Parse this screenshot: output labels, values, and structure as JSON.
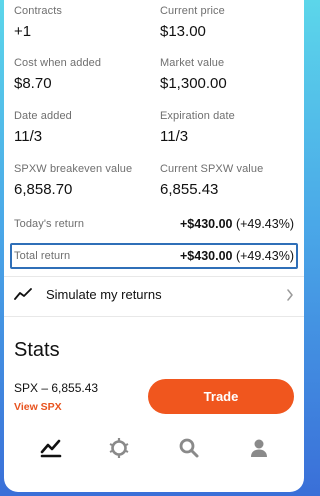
{
  "details": [
    {
      "label": "Contracts",
      "value": "+1"
    },
    {
      "label": "Current price",
      "value": "$13.00"
    },
    {
      "label": "Cost when added",
      "value": "$8.70"
    },
    {
      "label": "Market value",
      "value": "$1,300.00"
    },
    {
      "label": "Date added",
      "value": "11/3"
    },
    {
      "label": "Expiration date",
      "value": "11/3"
    },
    {
      "label": "SPXW breakeven value",
      "value": "6,858.70"
    },
    {
      "label": "Current SPXW value",
      "value": "6,855.43"
    }
  ],
  "todays_return": {
    "label": "Today's return",
    "amount": "+$430.00",
    "percent": "(+49.43%)"
  },
  "total_return": {
    "label": "Total return",
    "amount": "+$430.00",
    "percent": "(+49.43%)"
  },
  "simulate": {
    "label": "Simulate my returns"
  },
  "stats": {
    "title": "Stats",
    "underlying": "SPX – 6,855.43",
    "view_link": "View SPX",
    "trade_button": "Trade"
  },
  "nav": {
    "icons": [
      "chart-icon",
      "crypto-icon",
      "search-icon",
      "account-icon"
    ]
  },
  "colors": {
    "accent": "#f0561e",
    "highlight_border": "#2f6fb8"
  }
}
